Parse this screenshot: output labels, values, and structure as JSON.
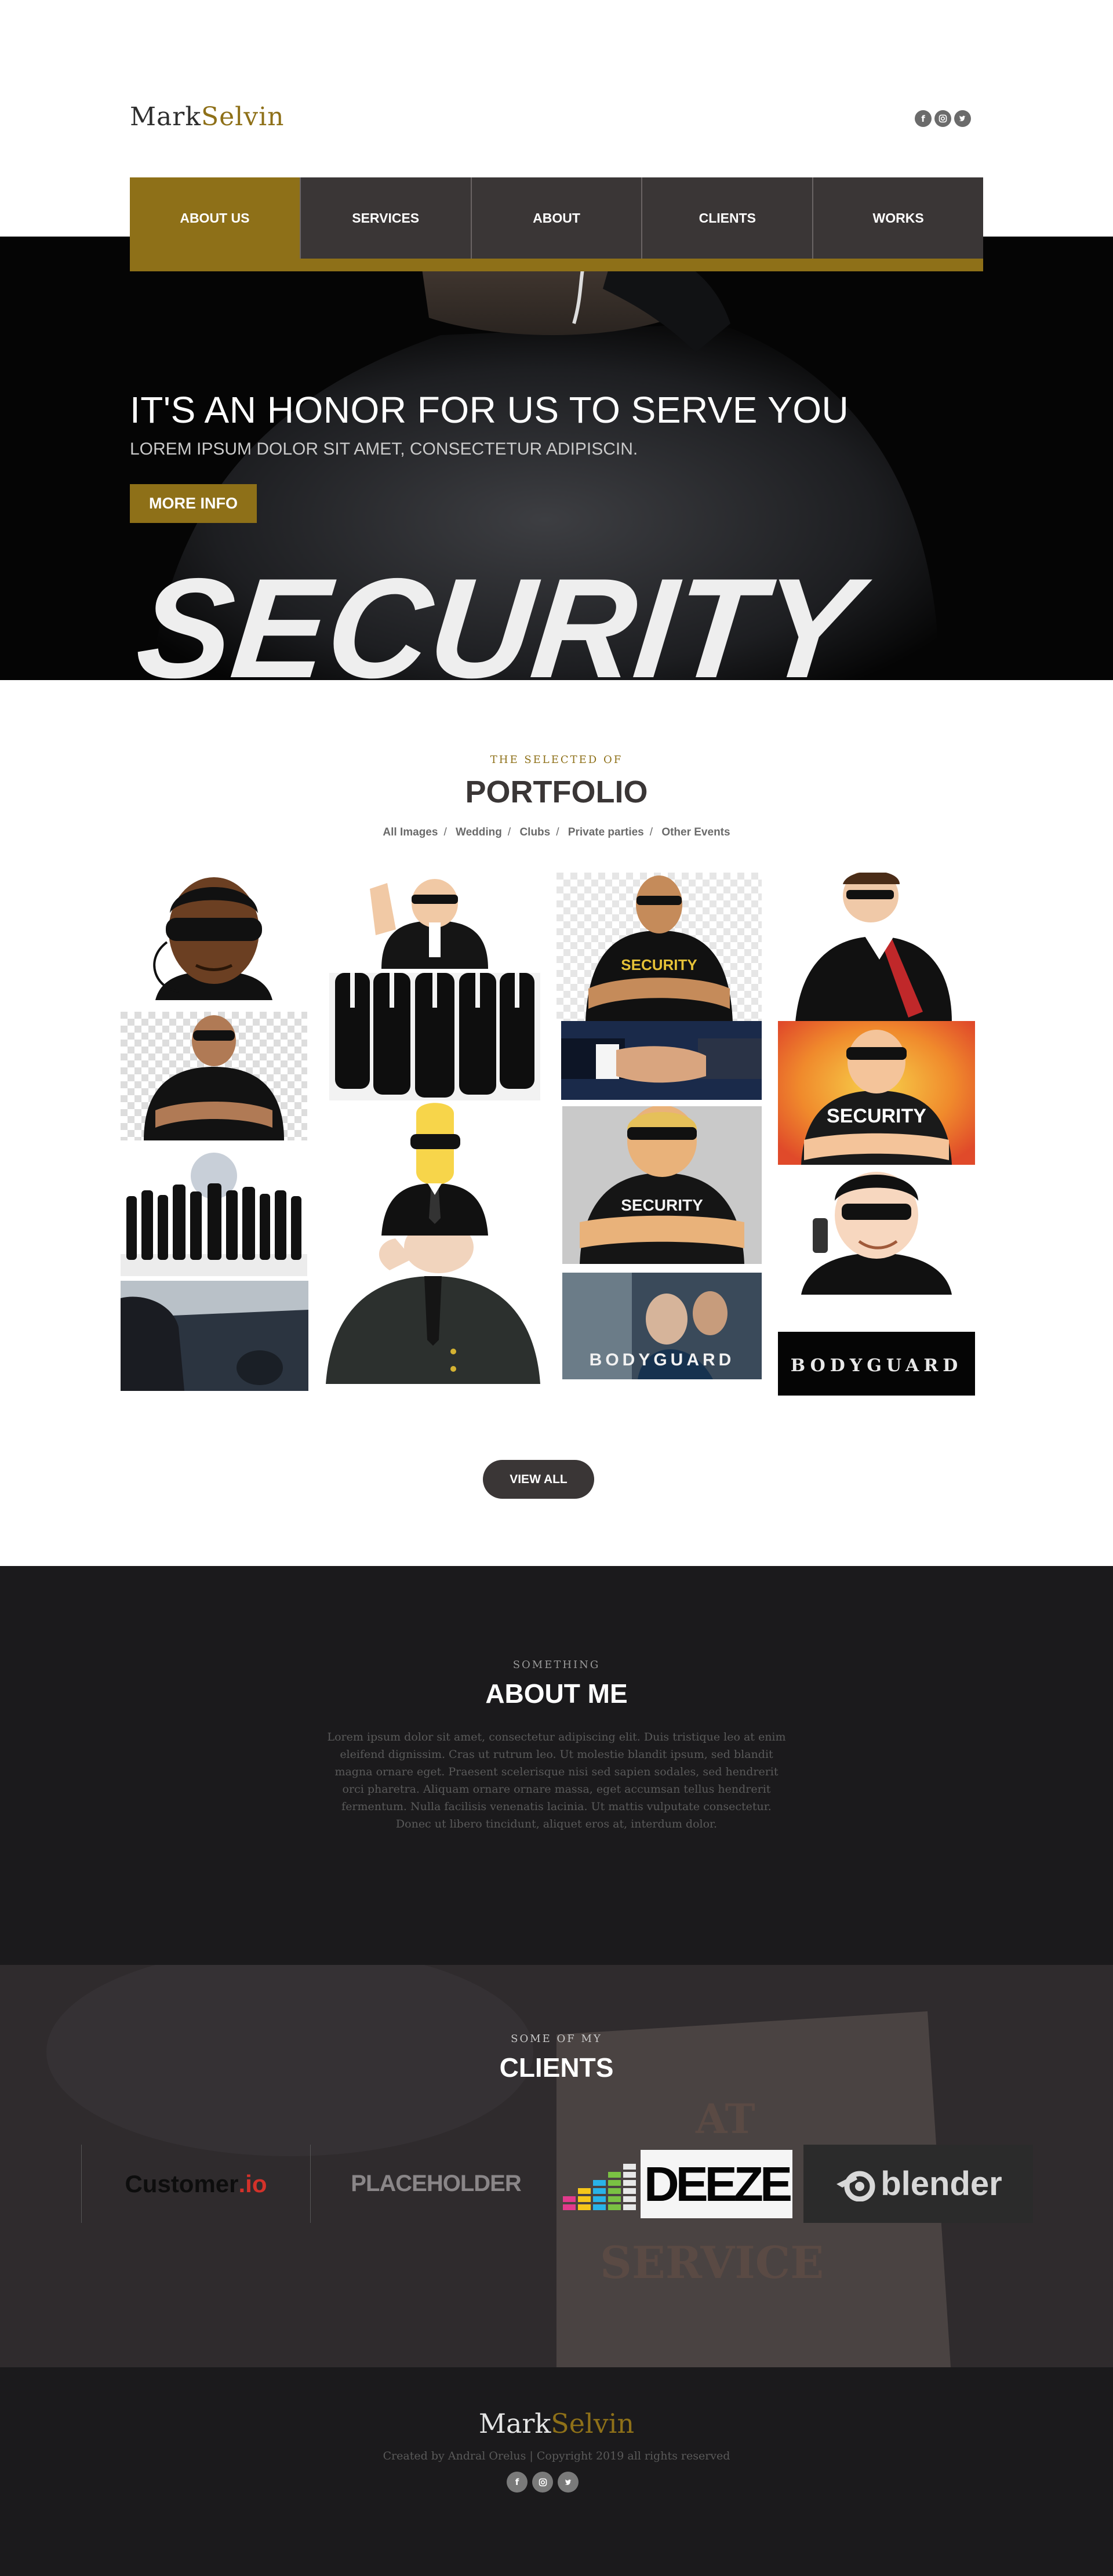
{
  "brand": {
    "first": "Mark",
    "second": "Selvin"
  },
  "social_icons": [
    "facebook-icon",
    "instagram-icon",
    "twitter-icon"
  ],
  "nav": {
    "items": [
      {
        "label": "ABOUT US",
        "active": true
      },
      {
        "label": "SERVICES",
        "active": false
      },
      {
        "label": "ABOUT",
        "active": false
      },
      {
        "label": "CLIENTS",
        "active": false
      },
      {
        "label": "WORKS",
        "active": false
      }
    ]
  },
  "hero": {
    "title": "IT'S AN HONOR FOR US TO SERVE YOU",
    "subtitle": "LOREM IPSUM DOLOR SIT AMET, CONSECTETUR ADIPISCIN.",
    "button": "MORE INFO",
    "jacket_text": "SECURITY"
  },
  "portfolio": {
    "kicker": "THE SELECTED OF",
    "title": "PORTFOLIO",
    "filters": [
      "All Images",
      "Wedding",
      "Clubs",
      "Private parties",
      "Other Events"
    ],
    "button": "VIEW ALL",
    "image_texts": {
      "security_shirt": "SECURITY",
      "security_comic": "SECURITY",
      "security_muscle": "SECURITY",
      "bodyguard_film": "BODYGUARD",
      "bodyguard_banner": "BODYGUARD"
    }
  },
  "about": {
    "kicker": "SOMETHING",
    "title": "ABOUT ME",
    "text": "Lorem ipsum dolor sit amet, consectetur adipiscing elit. Duis tristique leo at enim eleifend dignissim. Cras ut rutrum leo. Ut molestie blandit ipsum, sed blandit magna ornare eget. Praesent scelerisque nisi sed sapien sodales, sed hendrerit orci pharetra. Aliquam ornare ornare massa, eget accumsan tellus hendrerit fermentum. Nulla facilisis venenatis lacinia. Ut mattis vulputate consectetur. Donec ut libero tincidunt, aliquet eros at, interdum dolor."
  },
  "clients": {
    "kicker": "SOME OF MY",
    "title": "CLIENTS",
    "background_text": [
      "AT",
      "SERVICE"
    ],
    "logos": [
      {
        "name": "Customer",
        "suffix": ".io"
      },
      {
        "name": "PLACEHOLDER"
      },
      {
        "name": "DEEZE"
      },
      {
        "name": "blender"
      }
    ]
  },
  "footer": {
    "copyright": "Created by Andral Orelus | Copyright 2019 all rights reserved"
  },
  "colors": {
    "gold": "#8e7018",
    "nav_dark": "#3a3636",
    "dark_bg": "#1b1a1c"
  }
}
